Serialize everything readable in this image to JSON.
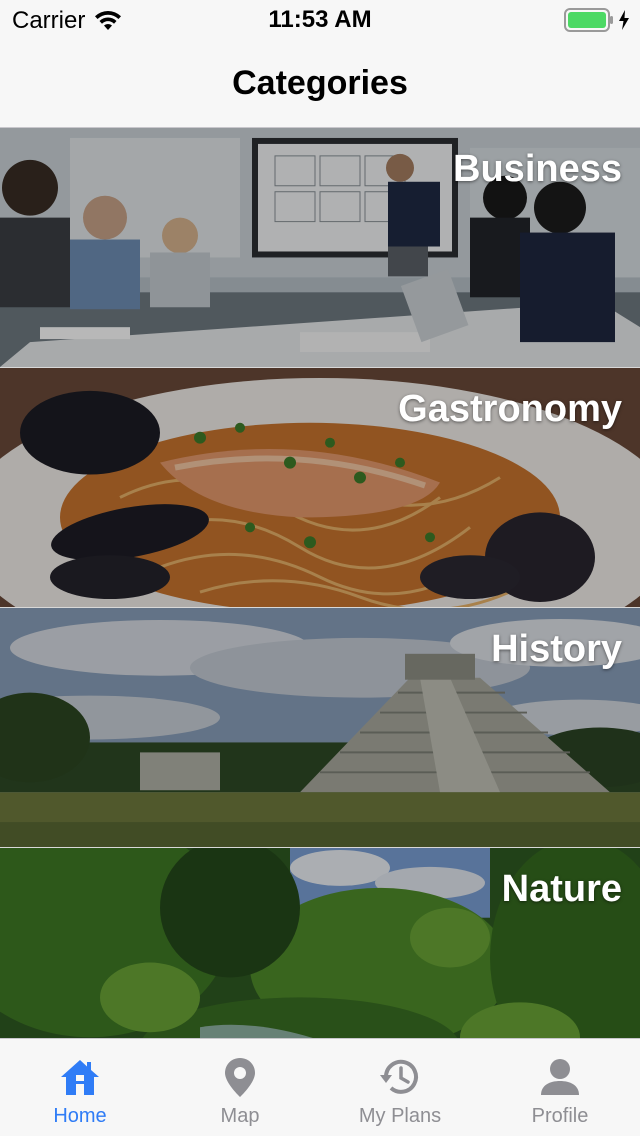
{
  "status_bar": {
    "carrier": "Carrier",
    "time": "11:53 AM",
    "battery_level": 1.0,
    "battery_color": "#4cd964"
  },
  "nav": {
    "title": "Categories"
  },
  "categories": [
    {
      "label": "Business"
    },
    {
      "label": "Gastronomy"
    },
    {
      "label": "History"
    },
    {
      "label": "Nature"
    }
  ],
  "tab_bar": {
    "active_color": "#2f7cf6",
    "inactive_color": "#8e8e93",
    "tabs": [
      {
        "label": "Home",
        "icon": "home-icon",
        "active": true
      },
      {
        "label": "Map",
        "icon": "map-pin-icon",
        "active": false
      },
      {
        "label": "My Plans",
        "icon": "history-icon",
        "active": false
      },
      {
        "label": "Profile",
        "icon": "profile-icon",
        "active": false
      }
    ]
  }
}
